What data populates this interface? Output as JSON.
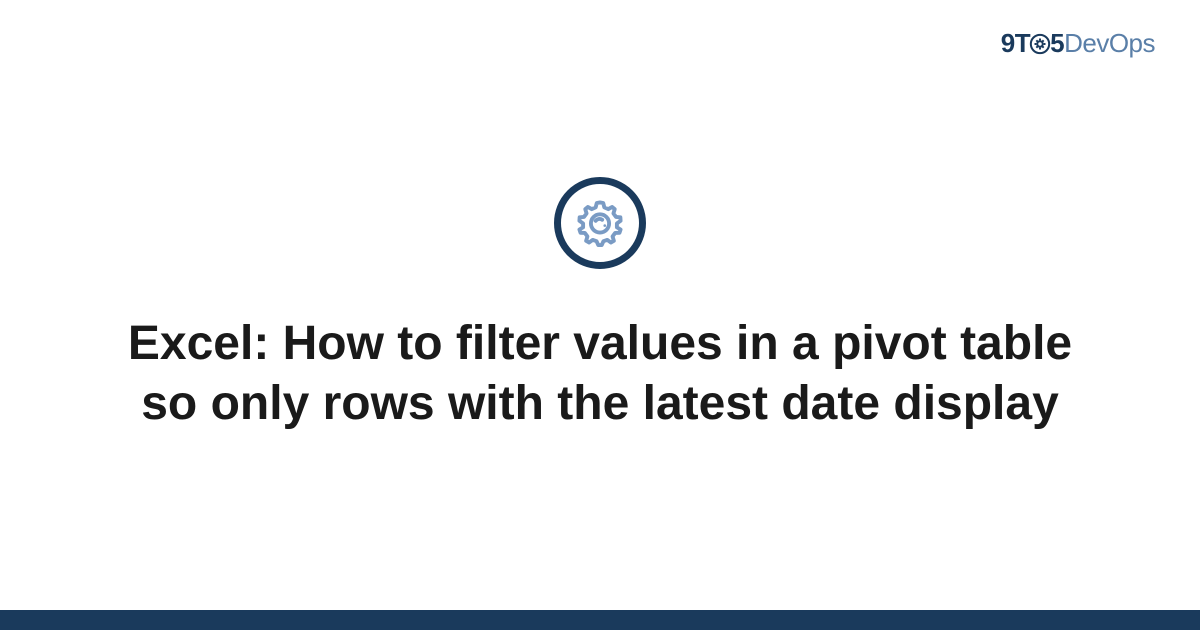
{
  "header": {
    "logo": {
      "part1": "9T",
      "part2": "5",
      "part3": "DevOps"
    }
  },
  "main": {
    "title": "Excel: How to filter values in a pivot table so only rows with the latest date display"
  },
  "colors": {
    "primary": "#1a3a5c",
    "secondary": "#5a7fa8",
    "iconFill": "#7a9bc4"
  }
}
